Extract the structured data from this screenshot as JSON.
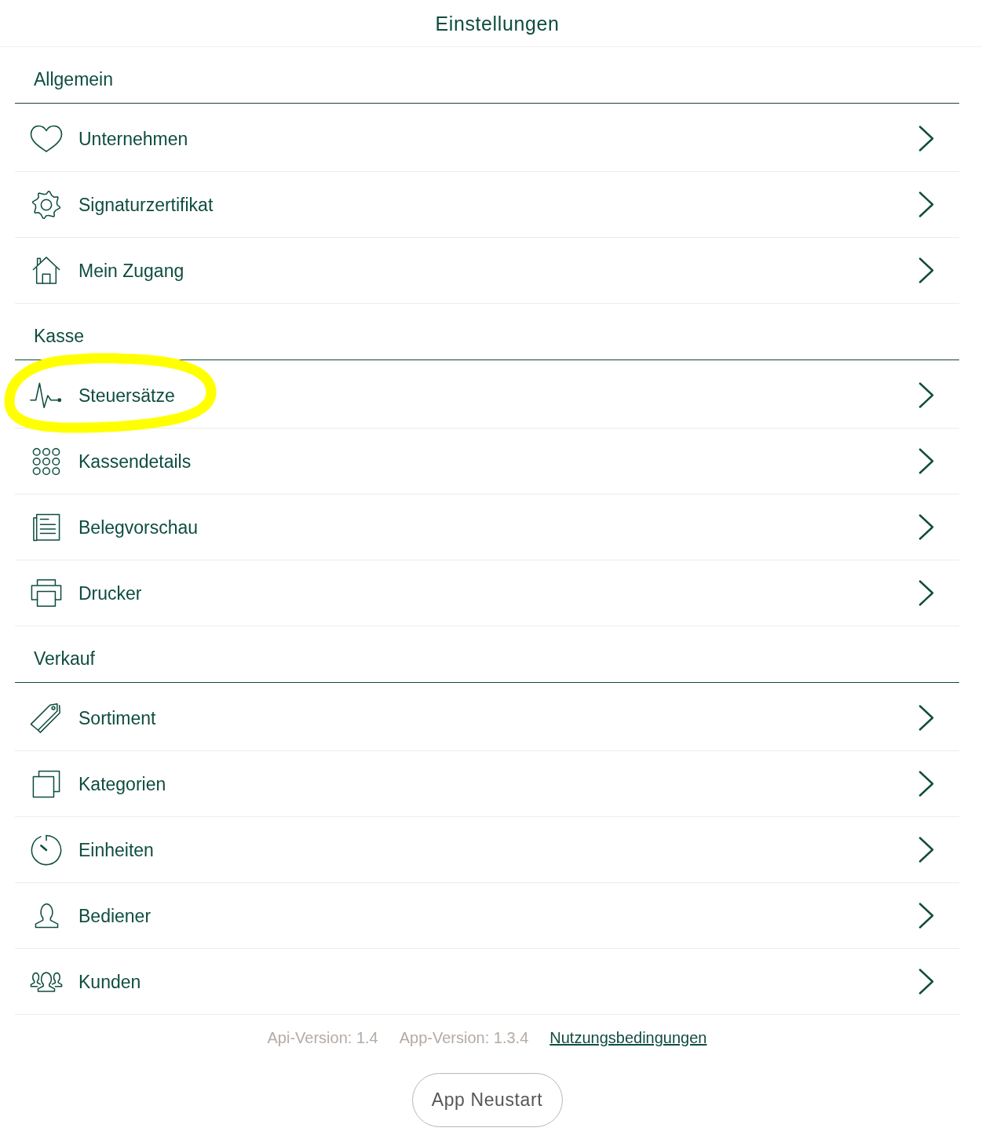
{
  "header": {
    "title": "Einstellungen"
  },
  "sections": [
    {
      "title": "Allgemein",
      "items": [
        {
          "label": "Unternehmen",
          "highlighted": false
        },
        {
          "label": "Signaturzertifikat",
          "highlighted": false
        },
        {
          "label": "Mein Zugang",
          "highlighted": false
        }
      ]
    },
    {
      "title": "Kasse",
      "items": [
        {
          "label": "Steuersätze",
          "highlighted": true
        },
        {
          "label": "Kassendetails",
          "highlighted": false
        },
        {
          "label": "Belegvorschau",
          "highlighted": false
        },
        {
          "label": "Drucker",
          "highlighted": false
        }
      ]
    },
    {
      "title": "Verkauf",
      "items": [
        {
          "label": "Sortiment",
          "highlighted": false
        },
        {
          "label": "Kategorien",
          "highlighted": false
        },
        {
          "label": "Einheiten",
          "highlighted": false
        },
        {
          "label": "Bediener",
          "highlighted": false
        },
        {
          "label": "Kunden",
          "highlighted": false
        }
      ]
    }
  ],
  "footer": {
    "versions": [
      "Api-Version: 1.4",
      "App-Version: 1.3.4"
    ],
    "link": "Nutzungsbedingungen"
  },
  "restart_button": {
    "label": "App Neustart"
  }
}
